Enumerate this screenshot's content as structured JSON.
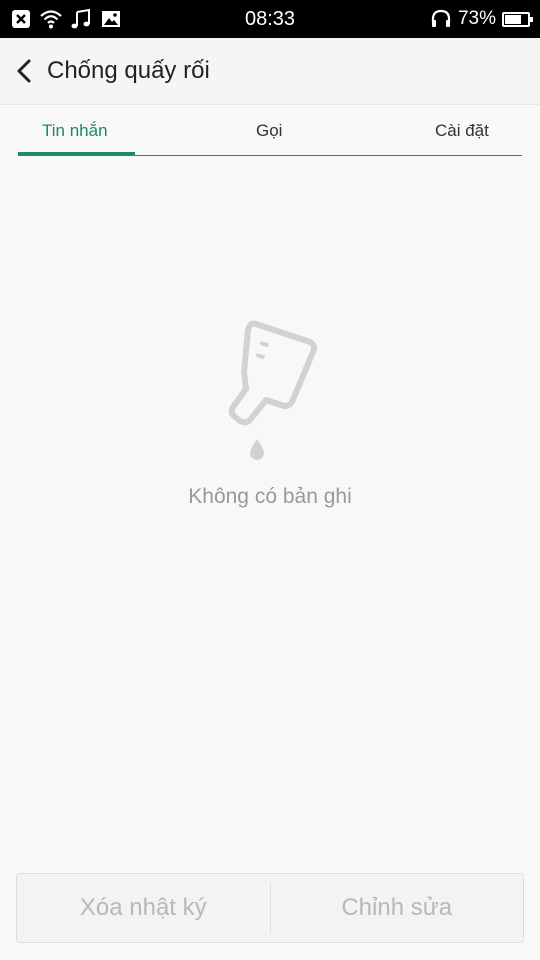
{
  "status_bar": {
    "time": "08:33",
    "battery_percent": "73%",
    "battery_level": 0.73,
    "icons": [
      "notification-x-icon",
      "wifi-icon",
      "music-note-icon",
      "image-icon",
      "headphones-icon",
      "battery-icon"
    ]
  },
  "header": {
    "title": "Chống quấy rối",
    "back_icon": "back-arrow-icon"
  },
  "tabs": [
    {
      "label": "Tin nhắn",
      "active": true
    },
    {
      "label": "Gọi",
      "active": false
    },
    {
      "label": "Cài đặt",
      "active": false
    }
  ],
  "empty_state": {
    "icon": "empty-bottle-icon",
    "message": "Không có bản ghi"
  },
  "actions": {
    "clear_log_label": "Xóa nhật ký",
    "edit_label": "Chỉnh sửa"
  },
  "colors": {
    "accent": "#1f8a5e",
    "disabled_text": "#b8b8b8"
  }
}
